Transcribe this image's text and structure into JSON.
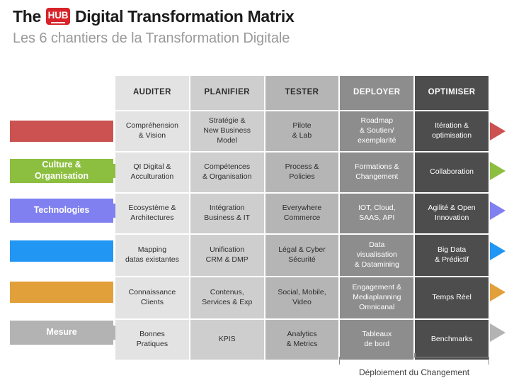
{
  "header": {
    "title_part1": "The",
    "logo_text": "HUB",
    "logo_icon": "hub-logo-icon",
    "title_part2": "Digital Transformation Matrix",
    "subtitle": "Les 6 chantiers de la Transformation Digitale",
    "logo_color": "#d8232a"
  },
  "matrix": {
    "columns": [
      {
        "label": "AUDITER",
        "shade": "#e3e3e3"
      },
      {
        "label": "PLANIFIER",
        "shade": "#cecece"
      },
      {
        "label": "TESTER",
        "shade": "#b5b5b5"
      },
      {
        "label": "DEPLOYER",
        "shade": "#8d8d8d"
      },
      {
        "label": "OPTIMISER",
        "shade": "#4d4d4d"
      }
    ],
    "rows": [
      {
        "left_label": "",
        "color": "#cc5252",
        "cells": [
          "Compréhension\n& Vision",
          "Stratégie &\nNew Business\nModel",
          "Pilote\n& Lab",
          "Roadmap\n& Soutien/\nexemplarité",
          "Itération &\noptimisation"
        ]
      },
      {
        "left_label": "Culture &\nOrganisation",
        "color": "#8cbf3f",
        "cells": [
          "QI Digital &\nAcculturation",
          "Compétences\n& Organisation",
          "Process &\nPolicies",
          "Formations &\nChangement",
          "Collaboration"
        ]
      },
      {
        "left_label": "Technologies",
        "color": "#8080f0",
        "cells": [
          "Ecosystème &\nArchitectures",
          "Intégration\nBusiness & IT",
          "Everywhere\nCommerce",
          "IOT, Cloud,\nSAAS, API",
          "Agilité & Open\nInnovation"
        ]
      },
      {
        "left_label": "",
        "color": "#2196f3",
        "cells": [
          "Mapping\ndatas existantes",
          "Unification\nCRM & DMP",
          "Légal & Cyber\nSécurité",
          "Data\nvisualisation\n& Datamining",
          "Big Data\n& Prédictif"
        ]
      },
      {
        "left_label": "",
        "color": "#e2a03a",
        "cells": [
          "Connaissance\nClients",
          "Contenus,\nServices & Exp",
          "Social, Mobile,\nVideo",
          "Engagement &\nMediaplanning\nOmnicanal",
          "Temps Réel"
        ]
      },
      {
        "left_label": "Mesure",
        "color": "#b3b3b3",
        "cells": [
          "Bonnes\nPratiques",
          "KPIS",
          "Analytics\n& Metrics",
          "Tableaux\nde bord",
          "Benchmarks"
        ]
      }
    ]
  },
  "footer": {
    "bracket_label": "Déploiement du Changement",
    "bracket_color": "#8c8c8c"
  }
}
